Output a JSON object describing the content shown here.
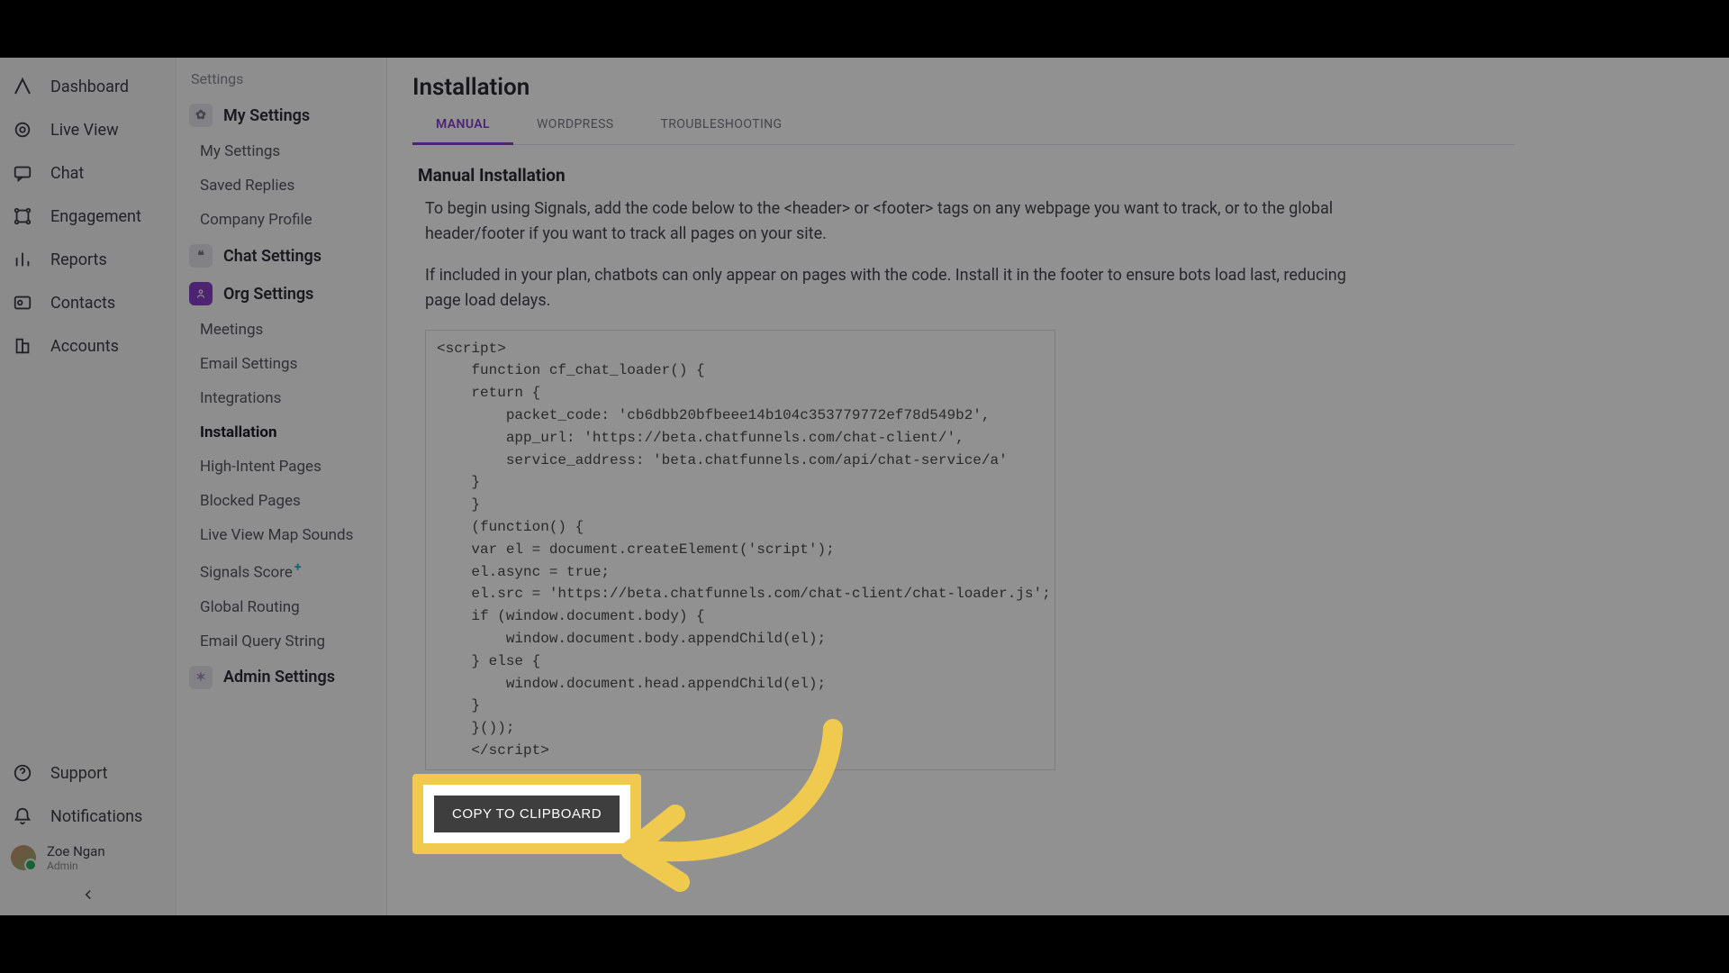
{
  "primary_nav": {
    "items": [
      {
        "label": "Dashboard"
      },
      {
        "label": "Live View"
      },
      {
        "label": "Chat"
      },
      {
        "label": "Engagement"
      },
      {
        "label": "Reports"
      },
      {
        "label": "Contacts"
      },
      {
        "label": "Accounts"
      }
    ],
    "support_label": "Support",
    "notifications_label": "Notifications",
    "user_name": "Zoe Ngan",
    "user_role": "Admin"
  },
  "settings_panel": {
    "heading": "Settings",
    "sections": {
      "my_settings": {
        "title": "My Settings",
        "items": [
          {
            "label": "My Settings"
          },
          {
            "label": "Saved Replies"
          },
          {
            "label": "Company Profile"
          }
        ]
      },
      "chat_settings": {
        "title": "Chat Settings"
      },
      "org_settings": {
        "title": "Org Settings",
        "items": [
          {
            "label": "Meetings"
          },
          {
            "label": "Email Settings"
          },
          {
            "label": "Integrations"
          },
          {
            "label": "Installation"
          },
          {
            "label": "High-Intent Pages"
          },
          {
            "label": "Blocked Pages"
          },
          {
            "label": "Live View Map Sounds"
          },
          {
            "label": "Signals Score"
          },
          {
            "label": "Global Routing"
          },
          {
            "label": "Email Query String"
          }
        ]
      },
      "admin_settings": {
        "title": "Admin Settings"
      }
    }
  },
  "main": {
    "title": "Installation",
    "tabs": [
      {
        "label": "MANUAL"
      },
      {
        "label": "WORDPRESS"
      },
      {
        "label": "TROUBLESHOOTING"
      }
    ],
    "subhead": "Manual Installation",
    "p1": "To begin using Signals, add the code below to the <header> or <footer> tags on any webpage you want to track, or to the global header/footer if you want to track all pages on your site.",
    "p2": "If included in your plan, chatbots can only appear on pages with the code. Install it in the footer to ensure bots load last, reducing page load delays.",
    "code": "<script>\n    function cf_chat_loader() {\n    return {\n        packet_code: 'cb6dbb20bfbeee14b104c353779772ef78d549b2',\n        app_url: 'https://beta.chatfunnels.com/chat-client/',\n        service_address: 'beta.chatfunnels.com/api/chat-service/a'\n    }\n    }\n    (function() {\n    var el = document.createElement('script');\n    el.async = true;\n    el.src = 'https://beta.chatfunnels.com/chat-client/chat-loader.js';\n    if (window.document.body) {\n        window.document.body.appendChild(el);\n    } else {\n        window.document.head.appendChild(el);\n    }\n    }());\n    </script>",
    "copy_button": "COPY TO CLIPBOARD"
  }
}
